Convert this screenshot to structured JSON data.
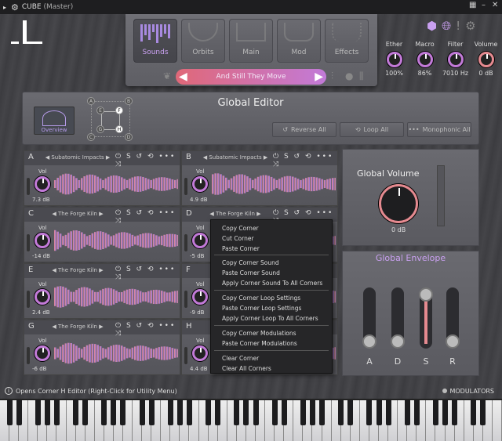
{
  "titlebar": {
    "title": "CUBE",
    "subtitle": "(Master)"
  },
  "nav": {
    "tabs": [
      {
        "label": "Sounds",
        "active": true
      },
      {
        "label": "Orbits"
      },
      {
        "label": "Main"
      },
      {
        "label": "Mod"
      },
      {
        "label": "Effects"
      }
    ],
    "preset": "And Still They Move"
  },
  "macros": [
    {
      "name": "Ether",
      "value": "100%"
    },
    {
      "name": "Macro",
      "value": "86%"
    },
    {
      "name": "Filter",
      "value": "7010 Hz"
    },
    {
      "name": "Volume",
      "value": "0 dB"
    }
  ],
  "global_editor": {
    "title": "Global Editor",
    "overview": "Overview",
    "buttons": {
      "reverse": "Reverse All",
      "loop": "Loop All",
      "mono": "Monophonic All"
    },
    "cube_nodes": [
      "A",
      "B",
      "E",
      "F",
      "G",
      "H",
      "C",
      "D"
    ]
  },
  "corners": [
    {
      "letter": "A",
      "sound": "Subatomic Impacts",
      "vol_label": "Vol",
      "db": "7.3 dB"
    },
    {
      "letter": "B",
      "sound": "Subatomic Impacts",
      "vol_label": "Vol",
      "db": "4.9 dB"
    },
    {
      "letter": "C",
      "sound": "The Forge Kiln",
      "vol_label": "Vol",
      "db": "-14 dB"
    },
    {
      "letter": "D",
      "sound": "The Forge Kiln",
      "vol_label": "Vol",
      "db": "-5 dB"
    },
    {
      "letter": "E",
      "sound": "The Forge Kiln",
      "vol_label": "Vol",
      "db": "2.4 dB"
    },
    {
      "letter": "F",
      "sound": "",
      "vol_label": "Vol",
      "db": "-9 dB"
    },
    {
      "letter": "G",
      "sound": "The Forge Kiln",
      "vol_label": "Vol",
      "db": "-6 dB"
    },
    {
      "letter": "H",
      "sound": "",
      "vol_label": "Vol",
      "db": "4.4 dB"
    }
  ],
  "corner_tools": "⏻ S ↺ ⟲ ••• ⤨",
  "global_volume": {
    "title": "Global Volume",
    "value": "0 dB"
  },
  "global_envelope": {
    "title": "Global Envelope",
    "labels": [
      "A",
      "D",
      "S",
      "R"
    ],
    "levels": [
      0.0,
      0.0,
      1.0,
      0.0
    ]
  },
  "context_menu": [
    "Copy Corner",
    "Cut Corner",
    "Paste Corner",
    "Copy Corner Sound",
    "Paste Corner Sound",
    "Apply Corner Sound To All Corners",
    "Copy Corner Loop Settings",
    "Paste Corner Loop Settings",
    "Apply Corner Loop To All Corners",
    "Copy Corner Modulations",
    "Paste Corner Modulations",
    "Clear Corner",
    "Clear All Corners"
  ],
  "status": {
    "message": "Opens Corner H Editor (Right-Click for Utility Menu)",
    "modulators": "MODULATORS"
  },
  "colors": {
    "accent_pink": "#e58a90",
    "accent_purple": "#c27ad8"
  }
}
